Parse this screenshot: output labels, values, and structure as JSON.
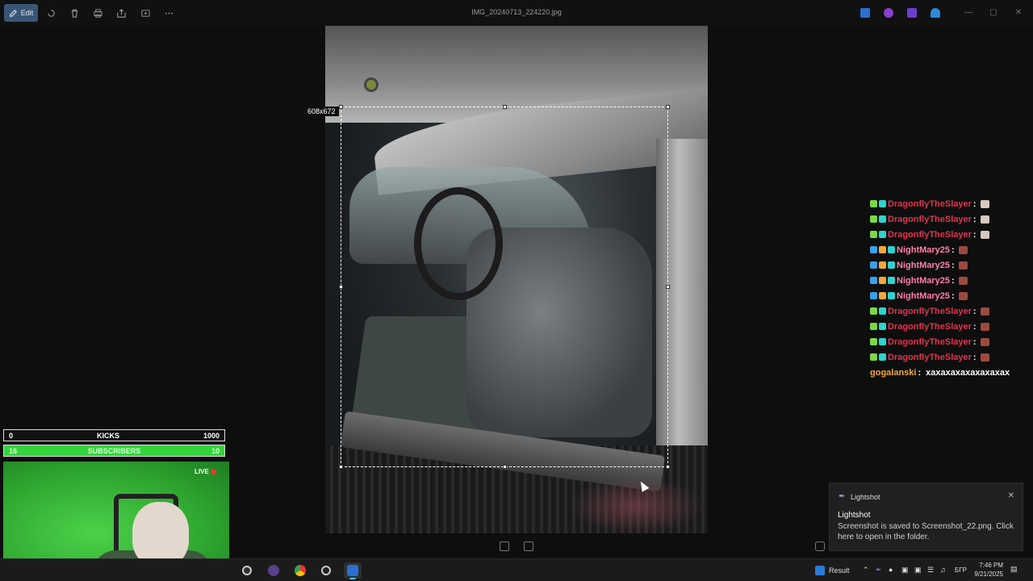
{
  "toolbar": {
    "edit_label": "Edit",
    "icons": [
      "rotate-icon",
      "delete-icon",
      "print-icon",
      "share-icon",
      "slideshow-icon",
      "more-icon"
    ]
  },
  "window": {
    "title": "IMG_20240713_224220.jpg"
  },
  "selection": {
    "size_label": "608x672"
  },
  "chat": {
    "messages": [
      {
        "user": "DragonflyTheSlayer",
        "color": "#e2344f",
        "badges": [
          "#7cd648",
          "#2fd3d0"
        ],
        "emote": "#d9c7c2",
        "text": ""
      },
      {
        "user": "DragonflyTheSlayer",
        "color": "#e2344f",
        "badges": [
          "#7cd648",
          "#2fd3d0"
        ],
        "emote": "#d9c7c2",
        "text": ""
      },
      {
        "user": "DragonflyTheSlayer",
        "color": "#e2344f",
        "badges": [
          "#7cd648",
          "#2fd3d0"
        ],
        "emote": "#d9c7c2",
        "text": ""
      },
      {
        "user": "NightMary25",
        "color": "#ff7fa8",
        "badges": [
          "#3aa0e8",
          "#f0a93a",
          "#2fd3d0"
        ],
        "emote": "#9c4a40",
        "text": ""
      },
      {
        "user": "NightMary25",
        "color": "#ff7fa8",
        "badges": [
          "#3aa0e8",
          "#f0a93a",
          "#2fd3d0"
        ],
        "emote": "#9c4a40",
        "text": ""
      },
      {
        "user": "NightMary25",
        "color": "#ff7fa8",
        "badges": [
          "#3aa0e8",
          "#f0a93a",
          "#2fd3d0"
        ],
        "emote": "#9c4a40",
        "text": ""
      },
      {
        "user": "NightMary25",
        "color": "#ff7fa8",
        "badges": [
          "#3aa0e8",
          "#f0a93a",
          "#2fd3d0"
        ],
        "emote": "#9c4a40",
        "text": ""
      },
      {
        "user": "DragonflyTheSlayer",
        "color": "#e2344f",
        "badges": [
          "#7cd648",
          "#2fd3d0"
        ],
        "emote": "#9c4a40",
        "text": ""
      },
      {
        "user": "DragonflyTheSlayer",
        "color": "#e2344f",
        "badges": [
          "#7cd648",
          "#2fd3d0"
        ],
        "emote": "#9c4a40",
        "text": ""
      },
      {
        "user": "DragonflyTheSlayer",
        "color": "#e2344f",
        "badges": [
          "#7cd648",
          "#2fd3d0"
        ],
        "emote": "#9c4a40",
        "text": ""
      },
      {
        "user": "DragonflyTheSlayer",
        "color": "#e2344f",
        "badges": [
          "#7cd648",
          "#2fd3d0"
        ],
        "emote": "#9c4a40",
        "text": ""
      },
      {
        "user": "gogalanski",
        "color": "#f0a93a",
        "badges": [],
        "emote": null,
        "text": "хахахахахахахахах"
      }
    ]
  },
  "stream": {
    "kicks": {
      "current": "0",
      "label": "KICKS",
      "goal": "1000"
    },
    "subscribers": {
      "current": "16",
      "label": "SUBSCRIBERS",
      "goal": "10"
    },
    "live_label": "LIVE"
  },
  "notification": {
    "app": "Lightshot",
    "title": "Lightshot",
    "body": "Screenshot is saved to Screenshot_22.png. Click here to open in the folder."
  },
  "taskbar": {
    "weather": "Result",
    "language": "БГР",
    "time": "7:46 PM",
    "date": "9/21/2025"
  }
}
